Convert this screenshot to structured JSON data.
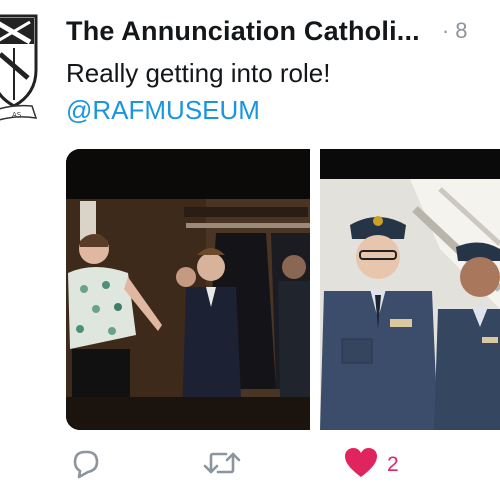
{
  "tweet": {
    "display_name": "The Annunciation Catholi...",
    "separator": "·",
    "timestamp": "8",
    "text": "Really getting into role!",
    "mention": "@RAFMUSEUM",
    "media": [
      {
        "kind": "photo",
        "description_icon": "photo-uniforms-dressing-room"
      },
      {
        "kind": "photo",
        "description_icon": "photo-children-raf-uniforms"
      }
    ]
  },
  "actions": {
    "reply_icon": "reply-icon",
    "retweet_icon": "retweet-icon",
    "like_icon": "heart-icon",
    "like_count": "2"
  },
  "colors": {
    "name": "#14171a",
    "mention": "#1b95e0",
    "muted": "#8c959d",
    "like": "#e0245e"
  },
  "avatar_icon": "school-crest-icon"
}
